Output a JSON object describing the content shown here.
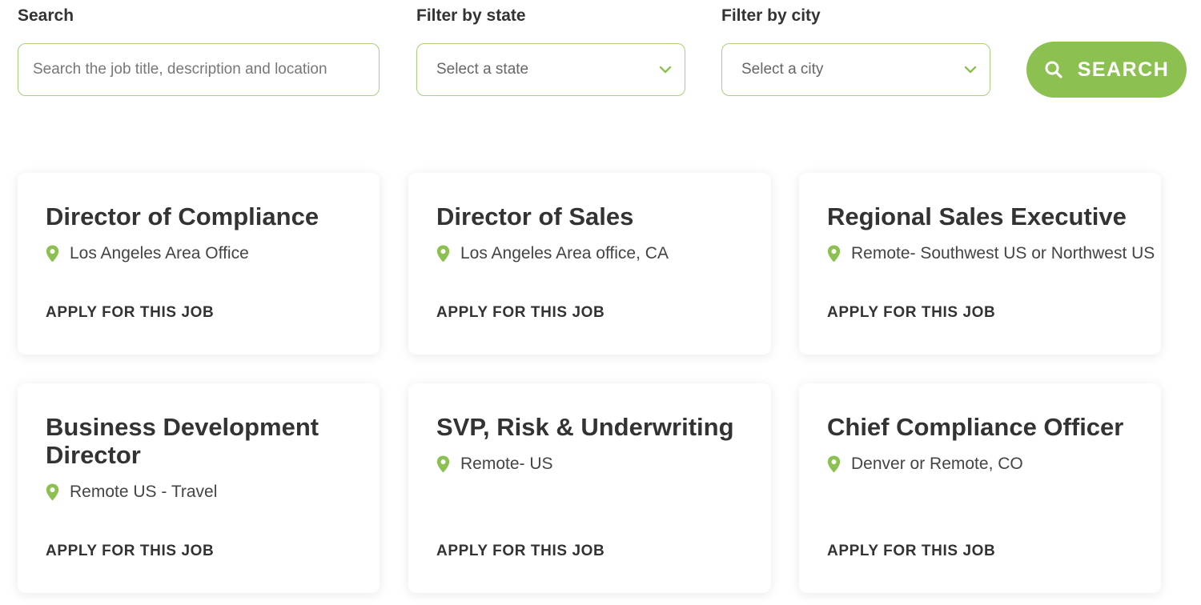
{
  "filters": {
    "search": {
      "label": "Search",
      "placeholder": "Search the job title, description and location",
      "value": ""
    },
    "state": {
      "label": "Filter by state",
      "selected": "Select a state"
    },
    "city": {
      "label": "Filter by city",
      "selected": "Select a city"
    },
    "search_button": {
      "label": "SEARCH"
    }
  },
  "jobs": [
    {
      "title": "Director of Compliance",
      "location": "Los Angeles Area Office",
      "apply_label": "APPLY FOR THIS JOB"
    },
    {
      "title": "Director of Sales",
      "location": "Los Angeles Area office, CA",
      "apply_label": "APPLY FOR THIS JOB"
    },
    {
      "title": "Regional Sales Executive",
      "location": "Remote- Southwest US or Northwest US",
      "apply_label": "APPLY FOR THIS JOB"
    },
    {
      "title": "Business Development Director",
      "location": "Remote US - Travel",
      "apply_label": "APPLY FOR THIS JOB"
    },
    {
      "title": "SVP, Risk & Underwriting",
      "location": "Remote- US",
      "apply_label": "APPLY FOR THIS JOB"
    },
    {
      "title": "Chief Compliance Officer",
      "location": "Denver or Remote, CO",
      "apply_label": "APPLY FOR THIS JOB"
    }
  ],
  "icons": {
    "search": "search-icon",
    "chevron": "chevron-down-icon",
    "location": "location-pin-icon"
  },
  "colors": {
    "accent": "#8cc152",
    "border": "#a8cf7d",
    "text": "#333333"
  }
}
